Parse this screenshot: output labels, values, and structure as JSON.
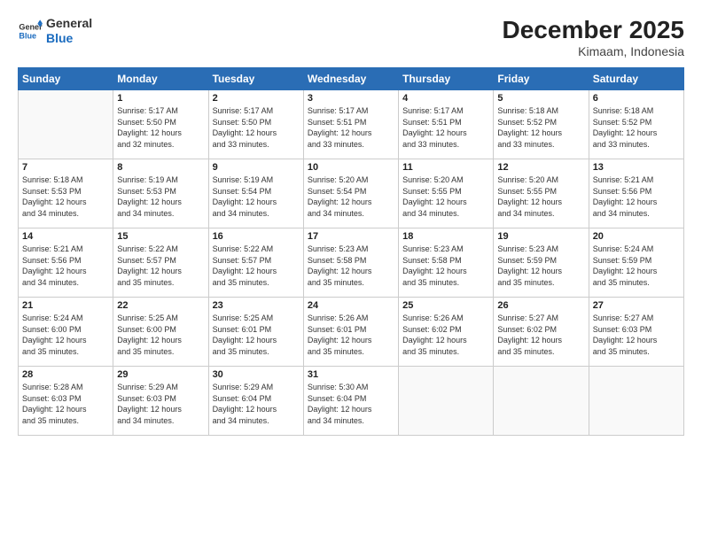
{
  "header": {
    "logo_line1": "General",
    "logo_line2": "Blue",
    "month_year": "December 2025",
    "location": "Kimaam, Indonesia"
  },
  "days_of_week": [
    "Sunday",
    "Monday",
    "Tuesday",
    "Wednesday",
    "Thursday",
    "Friday",
    "Saturday"
  ],
  "weeks": [
    [
      {
        "day": "",
        "info": ""
      },
      {
        "day": "1",
        "info": "Sunrise: 5:17 AM\nSunset: 5:50 PM\nDaylight: 12 hours\nand 32 minutes."
      },
      {
        "day": "2",
        "info": "Sunrise: 5:17 AM\nSunset: 5:50 PM\nDaylight: 12 hours\nand 33 minutes."
      },
      {
        "day": "3",
        "info": "Sunrise: 5:17 AM\nSunset: 5:51 PM\nDaylight: 12 hours\nand 33 minutes."
      },
      {
        "day": "4",
        "info": "Sunrise: 5:17 AM\nSunset: 5:51 PM\nDaylight: 12 hours\nand 33 minutes."
      },
      {
        "day": "5",
        "info": "Sunrise: 5:18 AM\nSunset: 5:52 PM\nDaylight: 12 hours\nand 33 minutes."
      },
      {
        "day": "6",
        "info": "Sunrise: 5:18 AM\nSunset: 5:52 PM\nDaylight: 12 hours\nand 33 minutes."
      }
    ],
    [
      {
        "day": "7",
        "info": "Sunrise: 5:18 AM\nSunset: 5:53 PM\nDaylight: 12 hours\nand 34 minutes."
      },
      {
        "day": "8",
        "info": "Sunrise: 5:19 AM\nSunset: 5:53 PM\nDaylight: 12 hours\nand 34 minutes."
      },
      {
        "day": "9",
        "info": "Sunrise: 5:19 AM\nSunset: 5:54 PM\nDaylight: 12 hours\nand 34 minutes."
      },
      {
        "day": "10",
        "info": "Sunrise: 5:20 AM\nSunset: 5:54 PM\nDaylight: 12 hours\nand 34 minutes."
      },
      {
        "day": "11",
        "info": "Sunrise: 5:20 AM\nSunset: 5:55 PM\nDaylight: 12 hours\nand 34 minutes."
      },
      {
        "day": "12",
        "info": "Sunrise: 5:20 AM\nSunset: 5:55 PM\nDaylight: 12 hours\nand 34 minutes."
      },
      {
        "day": "13",
        "info": "Sunrise: 5:21 AM\nSunset: 5:56 PM\nDaylight: 12 hours\nand 34 minutes."
      }
    ],
    [
      {
        "day": "14",
        "info": "Sunrise: 5:21 AM\nSunset: 5:56 PM\nDaylight: 12 hours\nand 34 minutes."
      },
      {
        "day": "15",
        "info": "Sunrise: 5:22 AM\nSunset: 5:57 PM\nDaylight: 12 hours\nand 35 minutes."
      },
      {
        "day": "16",
        "info": "Sunrise: 5:22 AM\nSunset: 5:57 PM\nDaylight: 12 hours\nand 35 minutes."
      },
      {
        "day": "17",
        "info": "Sunrise: 5:23 AM\nSunset: 5:58 PM\nDaylight: 12 hours\nand 35 minutes."
      },
      {
        "day": "18",
        "info": "Sunrise: 5:23 AM\nSunset: 5:58 PM\nDaylight: 12 hours\nand 35 minutes."
      },
      {
        "day": "19",
        "info": "Sunrise: 5:23 AM\nSunset: 5:59 PM\nDaylight: 12 hours\nand 35 minutes."
      },
      {
        "day": "20",
        "info": "Sunrise: 5:24 AM\nSunset: 5:59 PM\nDaylight: 12 hours\nand 35 minutes."
      }
    ],
    [
      {
        "day": "21",
        "info": "Sunrise: 5:24 AM\nSunset: 6:00 PM\nDaylight: 12 hours\nand 35 minutes."
      },
      {
        "day": "22",
        "info": "Sunrise: 5:25 AM\nSunset: 6:00 PM\nDaylight: 12 hours\nand 35 minutes."
      },
      {
        "day": "23",
        "info": "Sunrise: 5:25 AM\nSunset: 6:01 PM\nDaylight: 12 hours\nand 35 minutes."
      },
      {
        "day": "24",
        "info": "Sunrise: 5:26 AM\nSunset: 6:01 PM\nDaylight: 12 hours\nand 35 minutes."
      },
      {
        "day": "25",
        "info": "Sunrise: 5:26 AM\nSunset: 6:02 PM\nDaylight: 12 hours\nand 35 minutes."
      },
      {
        "day": "26",
        "info": "Sunrise: 5:27 AM\nSunset: 6:02 PM\nDaylight: 12 hours\nand 35 minutes."
      },
      {
        "day": "27",
        "info": "Sunrise: 5:27 AM\nSunset: 6:03 PM\nDaylight: 12 hours\nand 35 minutes."
      }
    ],
    [
      {
        "day": "28",
        "info": "Sunrise: 5:28 AM\nSunset: 6:03 PM\nDaylight: 12 hours\nand 35 minutes."
      },
      {
        "day": "29",
        "info": "Sunrise: 5:29 AM\nSunset: 6:03 PM\nDaylight: 12 hours\nand 34 minutes."
      },
      {
        "day": "30",
        "info": "Sunrise: 5:29 AM\nSunset: 6:04 PM\nDaylight: 12 hours\nand 34 minutes."
      },
      {
        "day": "31",
        "info": "Sunrise: 5:30 AM\nSunset: 6:04 PM\nDaylight: 12 hours\nand 34 minutes."
      },
      {
        "day": "",
        "info": ""
      },
      {
        "day": "",
        "info": ""
      },
      {
        "day": "",
        "info": ""
      }
    ]
  ]
}
